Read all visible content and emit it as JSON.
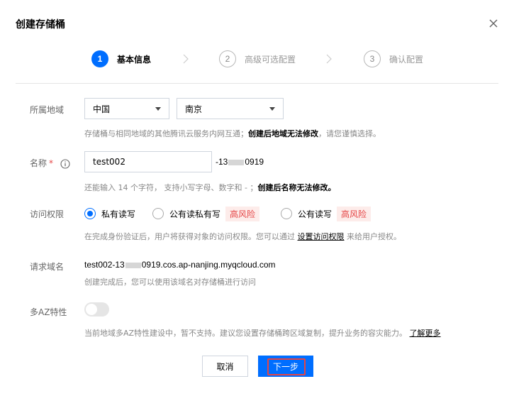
{
  "dialog": {
    "title": "创建存储桶"
  },
  "steps": [
    {
      "num": "1",
      "label": "基本信息"
    },
    {
      "num": "2",
      "label": "高级可选配置"
    },
    {
      "num": "3",
      "label": "确认配置"
    }
  ],
  "region": {
    "label": "所属地域",
    "country": "中国",
    "city": "南京",
    "hint_prefix": "存储桶与相同地域的其他腾讯云服务内网互通；",
    "hint_bold": "创建后地域无法修改",
    "hint_suffix": "，请您谨慎选择。"
  },
  "name": {
    "label": "名称",
    "required_mark": "*",
    "value": "test002",
    "suffix_prefix": "-13",
    "suffix_end": "0919",
    "hint_prefix": "还能输入 14 个字符， 支持小写字母、数字和 - ；",
    "hint_bold": "创建后名称无法修改。"
  },
  "access": {
    "label": "访问权限",
    "options": [
      {
        "label": "私有读写",
        "checked": true,
        "risk": ""
      },
      {
        "label": "公有读私有写",
        "checked": false,
        "risk": "高风险"
      },
      {
        "label": "公有读写",
        "checked": false,
        "risk": "高风险"
      }
    ],
    "hint_prefix": "在完成身份验证后，用户将获得对象的访问权限。您可以通过",
    "hint_link": "设置访问权限",
    "hint_suffix": "来给用户授权。"
  },
  "request_domain": {
    "label": "请求域名",
    "value_prefix": "test002-13",
    "value_suffix": "0919.cos.ap-nanjing.myqcloud.com",
    "hint": "创建完成后，您可以使用该域名对存储桶进行访问"
  },
  "multi_az": {
    "label": "多AZ特性",
    "enabled": false,
    "hint": "当前地域多AZ特性建设中，暂不支持。建议您设置存储桶跨区域复制，提升业务的容灾能力。",
    "link": "了解更多"
  },
  "footer": {
    "cancel_label": "取消",
    "next_label": "下一步"
  },
  "colors": {
    "primary": "#006eff",
    "danger": "#e54545",
    "risk_bg": "#fdecea"
  }
}
